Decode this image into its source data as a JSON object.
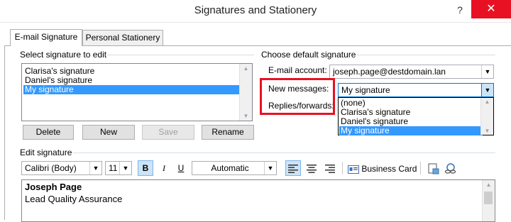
{
  "window": {
    "title": "Signatures and Stationery",
    "help": "?",
    "close": "✕"
  },
  "tabs": [
    {
      "label": "E-mail Signature"
    },
    {
      "label": "Personal Stationery"
    }
  ],
  "left": {
    "heading": "Select signature to edit",
    "signatures": [
      "Clarisa's signature",
      "Daniel's signature",
      "My signature"
    ],
    "buttons": {
      "delete": "Delete",
      "new": "New",
      "save": "Save",
      "rename": "Rename"
    }
  },
  "right": {
    "heading": "Choose default signature",
    "account_label": "E-mail account:",
    "account_value": "joseph.page@destdomain.lan",
    "new_messages_label": "New messages:",
    "new_messages_value": "My signature",
    "replies_label": "Replies/forwards:",
    "dropdown_options": [
      "(none)",
      "Clarisa's signature",
      "Daniel's signature",
      "My signature"
    ]
  },
  "editor": {
    "heading": "Edit signature",
    "font": "Calibri (Body)",
    "size": "11",
    "bold": "B",
    "italic": "I",
    "underline": "U",
    "color": "Automatic",
    "business_card": "Business Card",
    "lines": [
      "Joseph Page",
      "Lead Quality Assurance"
    ]
  },
  "colors": {
    "selection": "#3399ff",
    "close": "#e81123",
    "highlight": "#e81123"
  }
}
